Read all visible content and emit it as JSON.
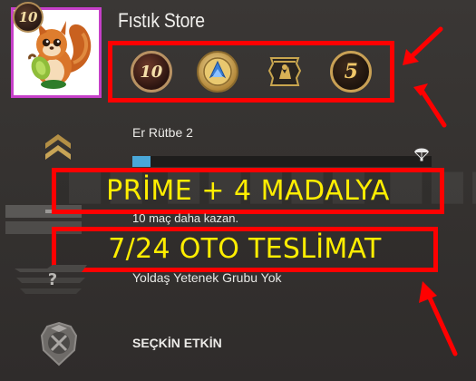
{
  "profile": {
    "username": "Fıstık Store",
    "level": "10"
  },
  "medals": {
    "coin_10_label": "10",
    "coin_5_label": "5"
  },
  "rank": {
    "name": "Er Rütbe 2",
    "xp_progress_fraction": 0.06,
    "win_hint": "10 maç daha kazan."
  },
  "promo": {
    "prime_text": "PRİME + 4 MADALYA",
    "delivery_text": "7/24 OTO TESLİMAT",
    "highlight_color": "#ff0000",
    "text_color": "#ffee00"
  },
  "group": {
    "label": "Yoldaş Yetenek Grubu Yok"
  },
  "elite": {
    "label": "SEÇKİN ETKİN"
  },
  "colors": {
    "background": "#363331",
    "xp_fill": "#4aa7d8",
    "avatar_border": "#c640c9"
  }
}
